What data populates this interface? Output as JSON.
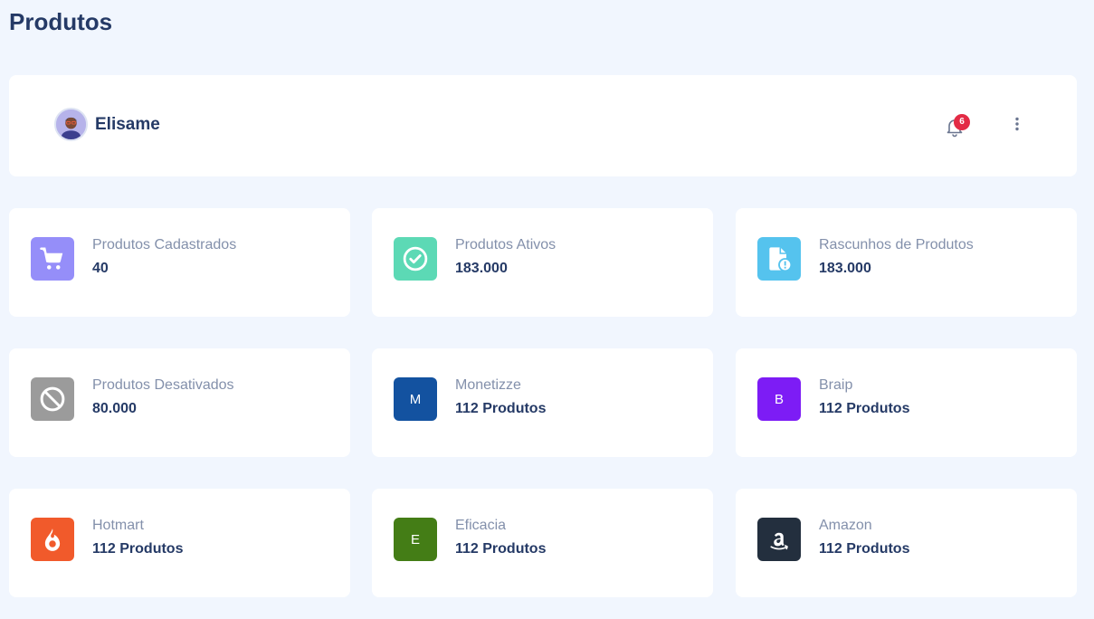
{
  "page": {
    "title": "Produtos"
  },
  "header": {
    "user_name": "Elisame",
    "notification_count": "6",
    "bell_icon": "bell-icon",
    "menu_icon": "more-vertical-icon"
  },
  "stats": [
    {
      "label": "Produtos Cadastrados",
      "value": "40",
      "icon": "cart-icon",
      "color": "#958ef9"
    },
    {
      "label": "Produtos Ativos",
      "value": "183.000",
      "icon": "check-circle-icon",
      "color": "#5cd9b5"
    },
    {
      "label": "Rascunhos de Produtos",
      "value": "183.000",
      "icon": "draft-file-icon",
      "color": "#55c3ee"
    },
    {
      "label": "Produtos Desativados",
      "value": "80.000",
      "icon": "ban-icon",
      "color": "#9b9b9b"
    },
    {
      "label": "Monetizze",
      "value": "112 Produtos",
      "icon_letter": "M",
      "color": "#1352a0"
    },
    {
      "label": "Braip",
      "value": "112 Produtos",
      "icon_letter": "B",
      "color": "#7d1cf5"
    },
    {
      "label": "Hotmart",
      "value": "112 Produtos",
      "icon": "hotmart-flame-icon",
      "color": "#f15a2b"
    },
    {
      "label": "Eficacia",
      "value": "112 Produtos",
      "icon_letter": "E",
      "color": "#447d16"
    },
    {
      "label": "Amazon",
      "value": "112 Produtos",
      "icon": "amazon-logo-icon",
      "color": "#232f3e"
    }
  ]
}
